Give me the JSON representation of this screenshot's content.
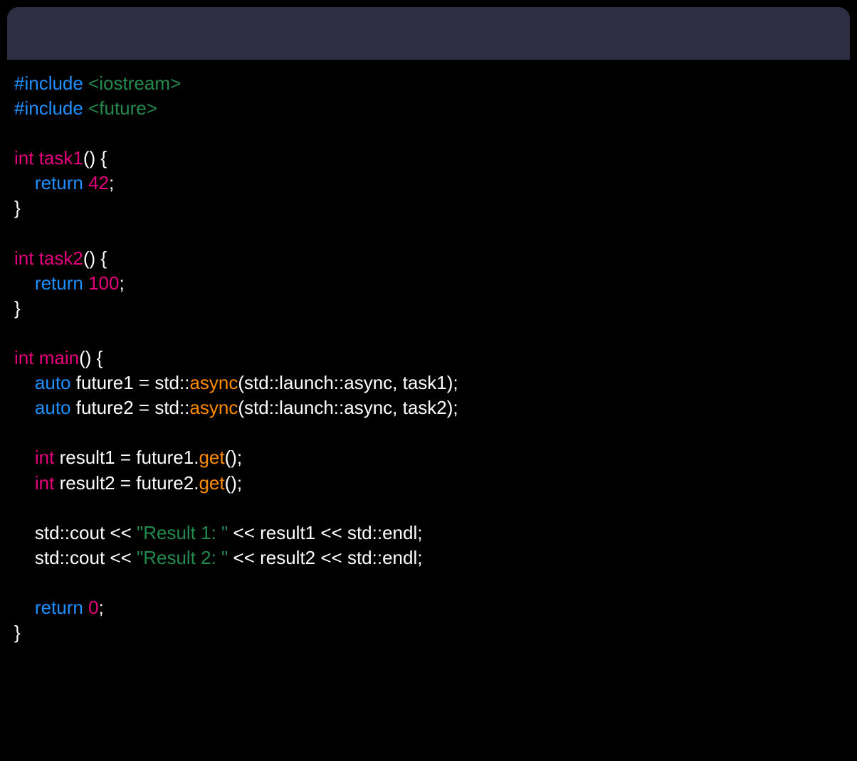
{
  "line1": {
    "a": "#include",
    "b": " ",
    "c": "<iostream>"
  },
  "line2": {
    "a": "#include",
    "b": " ",
    "c": "<future>"
  },
  "line4": {
    "a": "int",
    "b": " ",
    "c": "task1",
    "d": "() {"
  },
  "line5": {
    "a": "    ",
    "b": "return",
    "c": " ",
    "d": "42",
    "e": ";"
  },
  "line6": {
    "a": "}"
  },
  "line8": {
    "a": "int",
    "b": " ",
    "c": "task2",
    "d": "() {"
  },
  "line9": {
    "a": "    ",
    "b": "return",
    "c": " ",
    "d": "100",
    "e": ";"
  },
  "line10": {
    "a": "}"
  },
  "line12": {
    "a": "int",
    "b": " ",
    "c": "main",
    "d": "() {"
  },
  "line13": {
    "a": "    ",
    "b": "auto",
    "c": " future1 = std::",
    "d": "async",
    "e": "(std::launch::async, task1);"
  },
  "line14": {
    "a": "    ",
    "b": "auto",
    "c": " future2 = std::",
    "d": "async",
    "e": "(std::launch::async, task2);"
  },
  "line16": {
    "a": "    ",
    "b": "int",
    "c": " result1 = future1.",
    "d": "get",
    "e": "();"
  },
  "line17": {
    "a": "    ",
    "b": "int",
    "c": " result2 = future2.",
    "d": "get",
    "e": "();"
  },
  "line19": {
    "a": "    std::cout << ",
    "b": "\"Result 1: \"",
    "c": " << result1 << std::endl;"
  },
  "line20": {
    "a": "    std::cout << ",
    "b": "\"Result 2: \"",
    "c": " << result2 << std::endl;"
  },
  "line22": {
    "a": "    ",
    "b": "return",
    "c": " ",
    "d": "0",
    "e": ";"
  },
  "line23": {
    "a": "}"
  }
}
